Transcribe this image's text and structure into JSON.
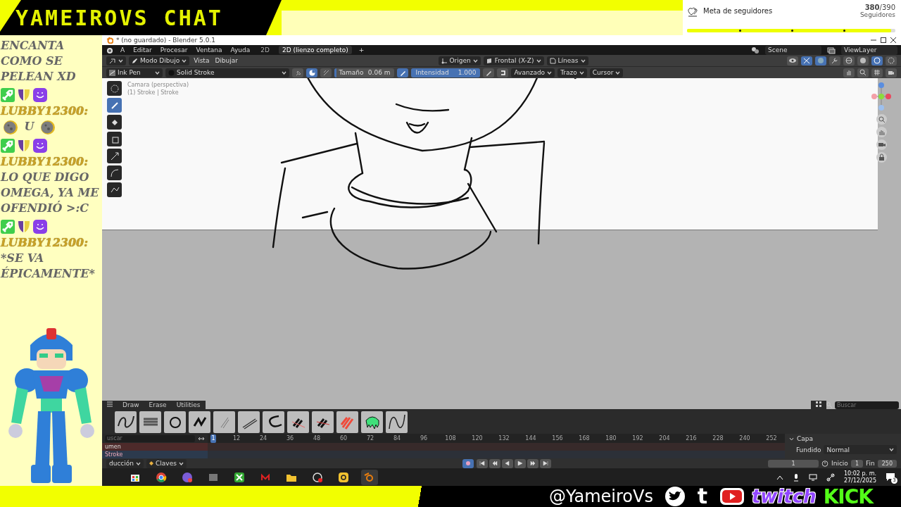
{
  "overlay": {
    "title": "YAMEIROVS CHAT",
    "goal": {
      "label": "Meta de seguidores",
      "count": "**380**/390",
      "unit": "Seguidores",
      "level": 0.98
    }
  },
  "chat": [
    {
      "kind": "continuation",
      "parts": [
        {
          "kind": "text",
          "text": "ENCANTA COMO SE PELEAN XD"
        }
      ]
    },
    {
      "kind": "message",
      "user": "LUBBY12300:",
      "parts": [
        {
          "kind": "emote"
        },
        {
          "kind": "text",
          "text": "U"
        },
        {
          "kind": "emote"
        }
      ]
    },
    {
      "kind": "message",
      "user": "LUBBY12300:",
      "parts": [
        {
          "kind": "text",
          "text": "LO QUE DIGO OMEGA, YA ME OFENDIÓ >:C"
        }
      ]
    },
    {
      "kind": "message",
      "user": "LUBBY12300:",
      "parts": [
        {
          "kind": "text",
          "text": "*SE VA ÉPICAMENTE*"
        }
      ]
    }
  ],
  "blender": {
    "title": "* (no guardado) - Blender 5.0.1",
    "menus": [
      "A",
      "Editar",
      "Procesar",
      "Ventana",
      "Ayuda"
    ],
    "workspaces": [
      {
        "label": "2D",
        "selected": false
      },
      {
        "label": "2D (lienzo completo)",
        "selected": true
      }
    ],
    "add_workspace": "+",
    "scene": "Scene",
    "view_layer": "ViewLayer",
    "header": {
      "mode": "Modo Dibujo",
      "menus": [
        "Vista",
        "Dibujar"
      ],
      "pivot": "Origen",
      "view": "Frontal (X-Z)",
      "placement": "Líneas"
    },
    "tool_settings": {
      "brush": "Ink Pen",
      "material": "Solid Stroke",
      "size": {
        "label": "Tamaño",
        "value": "0.06 m",
        "level": 0.03
      },
      "strength": {
        "label": "Intensidad",
        "value": "1.000",
        "level": 1
      },
      "menus": [
        "Avanzado",
        "Trazo",
        "Cursor"
      ]
    },
    "viewport": {
      "view_name": "Camara (perspectiva)",
      "object_info": "(1) Stroke | Stroke"
    },
    "tools": [
      {
        "selected": false
      },
      {
        "selected": true
      },
      {
        "selected": false
      },
      {
        "selected": false
      },
      {
        "selected": false
      },
      {
        "selected": false
      },
      {
        "selected": false
      }
    ],
    "asset_shelf": {
      "tabs": [
        "Draw",
        "Erase",
        "Utilities"
      ],
      "search_placeholder": "Buscar"
    },
    "timeline": {
      "search": "uscar",
      "channels": [
        "umen",
        "Stroke"
      ],
      "current_frame": "1",
      "ticks": [
        "12",
        "24",
        "36",
        "48",
        "60",
        "72",
        "84",
        "96",
        "108",
        "120",
        "132",
        "144",
        "156",
        "168",
        "180",
        "192",
        "204",
        "216",
        "228",
        "240",
        "252"
      ],
      "menus": [
        "ducción",
        "Claves"
      ],
      "frame": "1",
      "start_label": "Inicio",
      "start": "1",
      "end_label": "Fin",
      "end": "250"
    },
    "properties": {
      "panel": "Capa",
      "blend_label": "Fundido",
      "blend": "Normal"
    }
  },
  "taskbar": {
    "time": "10:02 p. m.",
    "date": "27/12/2025",
    "notifications": "3"
  },
  "footer": {
    "handle": "@YameiroVs",
    "platforms": [
      {
        "kind": "bird"
      },
      {
        "kind": "letter",
        "text": "t"
      },
      {
        "kind": "play"
      },
      {
        "kind": "twitch",
        "text": "twitch"
      },
      {
        "kind": "kick",
        "text": "KICK"
      }
    ]
  }
}
